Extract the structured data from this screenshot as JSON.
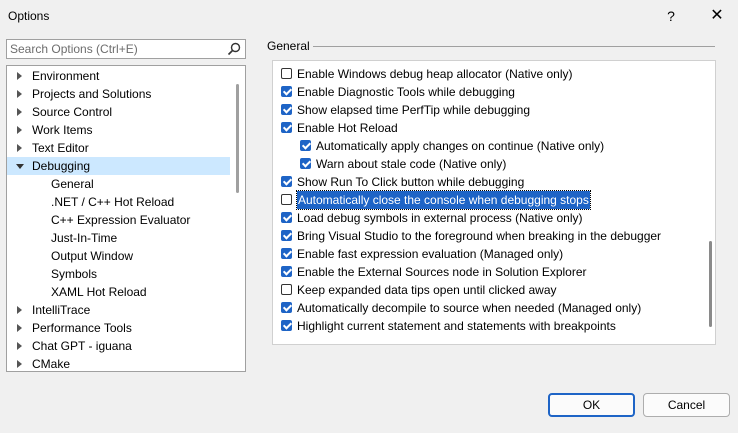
{
  "window": {
    "title": "Options",
    "help_label": "?",
    "close_label": "✕"
  },
  "search": {
    "placeholder": "Search Options (Ctrl+E)",
    "icon": "search-icon"
  },
  "tree": {
    "items": [
      {
        "label": "Environment",
        "expandable": true,
        "expanded": false
      },
      {
        "label": "Projects and Solutions",
        "expandable": true,
        "expanded": false
      },
      {
        "label": "Source Control",
        "expandable": true,
        "expanded": false
      },
      {
        "label": "Work Items",
        "expandable": true,
        "expanded": false
      },
      {
        "label": "Text Editor",
        "expandable": true,
        "expanded": false
      },
      {
        "label": "Debugging",
        "expandable": true,
        "expanded": true,
        "selected": true
      },
      {
        "label": "General",
        "child": true
      },
      {
        "label": ".NET / C++ Hot Reload",
        "child": true
      },
      {
        "label": "C++ Expression Evaluator",
        "child": true
      },
      {
        "label": "Just-In-Time",
        "child": true
      },
      {
        "label": "Output Window",
        "child": true
      },
      {
        "label": "Symbols",
        "child": true
      },
      {
        "label": "XAML Hot Reload",
        "child": true
      },
      {
        "label": "IntelliTrace",
        "expandable": true,
        "expanded": false
      },
      {
        "label": "Performance Tools",
        "expandable": true,
        "expanded": false
      },
      {
        "label": "Chat GPT - iguana",
        "expandable": true,
        "expanded": false
      },
      {
        "label": "CMake",
        "expandable": true,
        "expanded": false
      }
    ]
  },
  "panel": {
    "title": "General",
    "options": [
      {
        "label": "Enable Windows debug heap allocator (Native only)",
        "checked": false,
        "indent": 0
      },
      {
        "label": "Enable Diagnostic Tools while debugging",
        "checked": true,
        "indent": 0
      },
      {
        "label": "Show elapsed time PerfTip while debugging",
        "checked": true,
        "indent": 0
      },
      {
        "label": "Enable Hot Reload",
        "checked": true,
        "indent": 0
      },
      {
        "label": "Automatically apply changes on continue (Native only)",
        "checked": true,
        "indent": 1
      },
      {
        "label": "Warn about stale code (Native only)",
        "checked": true,
        "indent": 1
      },
      {
        "label": "Show Run To Click button while debugging",
        "checked": true,
        "indent": 0
      },
      {
        "label": "Automatically close the console when debugging stops",
        "checked": false,
        "indent": 0,
        "highlighted": true
      },
      {
        "label": "Load debug symbols in external process (Native only)",
        "checked": true,
        "indent": 0
      },
      {
        "label": "Bring Visual Studio to the foreground when breaking in the debugger",
        "checked": true,
        "indent": 0
      },
      {
        "label": "Enable fast expression evaluation (Managed only)",
        "checked": true,
        "indent": 0
      },
      {
        "label": "Enable the External Sources node in Solution Explorer",
        "checked": true,
        "indent": 0
      },
      {
        "label": "Keep expanded data tips open until clicked away",
        "checked": false,
        "indent": 0
      },
      {
        "label": "Automatically decompile to source when needed (Managed only)",
        "checked": true,
        "indent": 0
      },
      {
        "label": "Highlight current statement and statements with breakpoints",
        "checked": true,
        "indent": 0
      }
    ]
  },
  "buttons": {
    "ok": "OK",
    "cancel": "Cancel"
  },
  "colors": {
    "accent": "#1e64c6",
    "selection": "#cce8ff"
  }
}
